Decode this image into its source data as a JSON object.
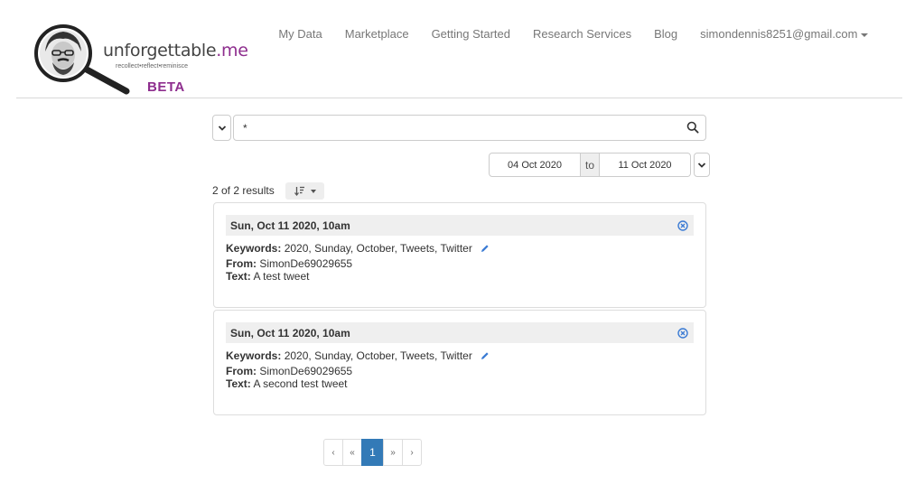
{
  "brand": {
    "name_main": "unforgettable",
    "name_suffix": ".me",
    "tagline": "recollect•reflect•reminisce",
    "badge": "BETA"
  },
  "nav": {
    "items": [
      "My Data",
      "Marketplace",
      "Getting Started",
      "Research Services",
      "Blog"
    ],
    "user_email": "simondennis8251@gmail.com"
  },
  "search": {
    "query": "*",
    "icon": "search-icon",
    "scope_icon": "chevron-down-icon"
  },
  "date_range": {
    "from": "04 Oct 2020",
    "to_label": "to",
    "until": "11 Oct 2020"
  },
  "results": {
    "count_text": "2 of 2 results",
    "sort_icon": "sort-icon"
  },
  "labels": {
    "keywords": "Keywords:",
    "from": "From:",
    "text": "Text:"
  },
  "items": [
    {
      "date": "Sun, Oct 11 2020, 10am",
      "keywords": "2020, Sunday, October, Tweets, Twitter",
      "from": "SimonDe69029655",
      "text": "A test tweet"
    },
    {
      "date": "Sun, Oct 11 2020, 10am",
      "keywords": "2020, Sunday, October, Tweets, Twitter",
      "from": "SimonDe69029655",
      "text": "A second test tweet"
    }
  ],
  "pagination": {
    "first": "‹",
    "prev": "«",
    "current": "1",
    "next": "»",
    "last": "›"
  },
  "colors": {
    "brand_purple": "#8e2e8e",
    "accent_blue": "#337ab7",
    "close_icon_blue": "#3b7bd4"
  }
}
